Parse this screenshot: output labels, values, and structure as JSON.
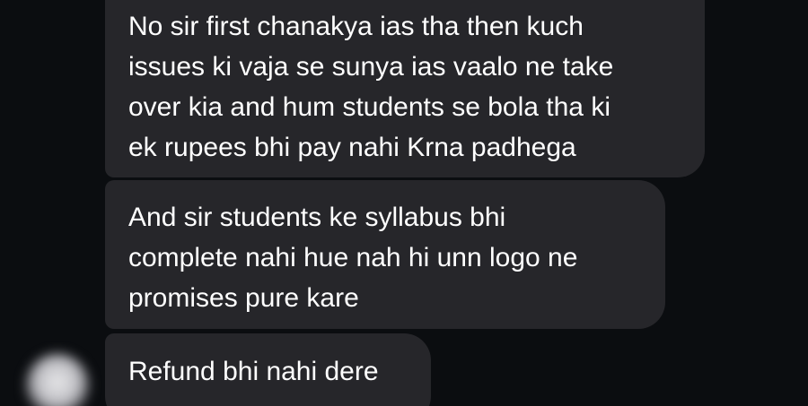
{
  "messages": [
    {
      "text": "No sir first chanakya ias tha then kuch\nissues ki vaja se sunya ias vaalo ne take\nover kia and hum students se bola tha ki\nek rupees bhi pay nahi Krna padhega"
    },
    {
      "text": "And sir students ke syllabus bhi\ncomplete nahi hue nah hi unn logo ne\npromises pure kare"
    },
    {
      "text": "Refund bhi nahi dere"
    }
  ],
  "colors": {
    "background": "#0b0d10",
    "bubble": "#26262a",
    "text": "#ffffff"
  },
  "icons": {
    "sender_avatar": "blurred-avatar-icon"
  }
}
